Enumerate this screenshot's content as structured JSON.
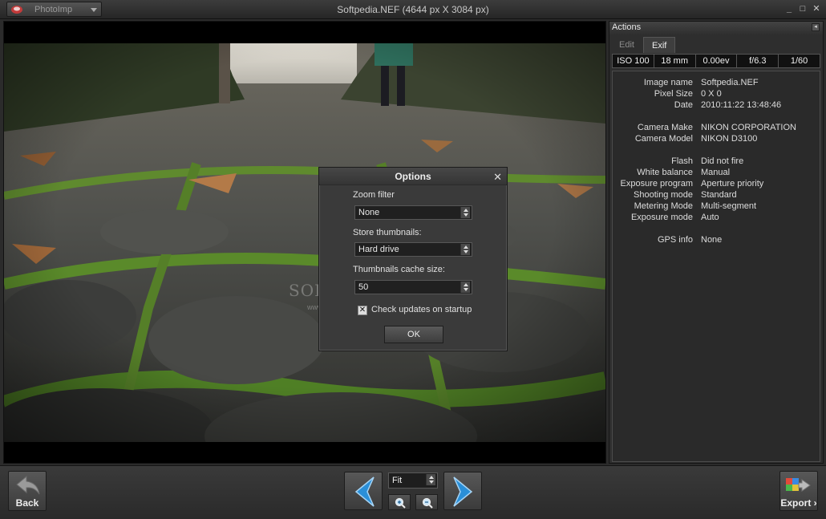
{
  "titlebar": {
    "app_name": "PhotoImp",
    "window_title": "Softpedia.NEF (4644 px X 3084 px)",
    "controls": [
      "_",
      "□",
      "✕"
    ]
  },
  "viewer": {
    "watermark": "SOFTPEDIA",
    "watermark_sub": "www.softpedia.com"
  },
  "options_dialog": {
    "title": "Options",
    "close": "✕",
    "zoom_filter_label": "Zoom filter",
    "zoom_filter_value": "None",
    "store_thumbnails_label": "Store thumbnails:",
    "store_thumbnails_value": "Hard drive",
    "cache_size_label": "Thumbnails cache size:",
    "cache_size_value": "50",
    "check_updates_mark": "✕",
    "check_updates_label": "Check updates on startup",
    "ok_label": "OK"
  },
  "panel": {
    "title": "Actions",
    "collapse": "◂",
    "tabs": [
      {
        "label": "Edit",
        "active": false
      },
      {
        "label": "Exif",
        "active": true
      }
    ],
    "exif_summary": [
      "ISO 100",
      "18 mm",
      "0.00ev",
      "f/6.3",
      "1/60"
    ],
    "exif_rows": [
      {
        "key": "Image name",
        "value": "Softpedia.NEF"
      },
      {
        "key": "Pixel Size",
        "value": "0 X 0"
      },
      {
        "key": "Date",
        "value": "2010:11:22 13:48:46"
      },
      {
        "key": "Camera Make",
        "value": "NIKON CORPORATION"
      },
      {
        "key": "Camera Model",
        "value": "NIKON D3100"
      },
      {
        "key": "Flash",
        "value": "Did not fire"
      },
      {
        "key": "White balance",
        "value": "Manual"
      },
      {
        "key": "Exposure program",
        "value": "Aperture priority"
      },
      {
        "key": "Shooting mode",
        "value": "Standard"
      },
      {
        "key": "Metering Mode",
        "value": "Multi-segment"
      },
      {
        "key": "Exposure mode",
        "value": "Auto"
      },
      {
        "key": "GPS info",
        "value": "None"
      }
    ]
  },
  "bottombar": {
    "back_label": "Back",
    "zoom_value": "Fit",
    "export_label": "Export ›"
  },
  "colors": {
    "accent_blue": "#2a8fd8",
    "background": "#2b2b2b"
  }
}
